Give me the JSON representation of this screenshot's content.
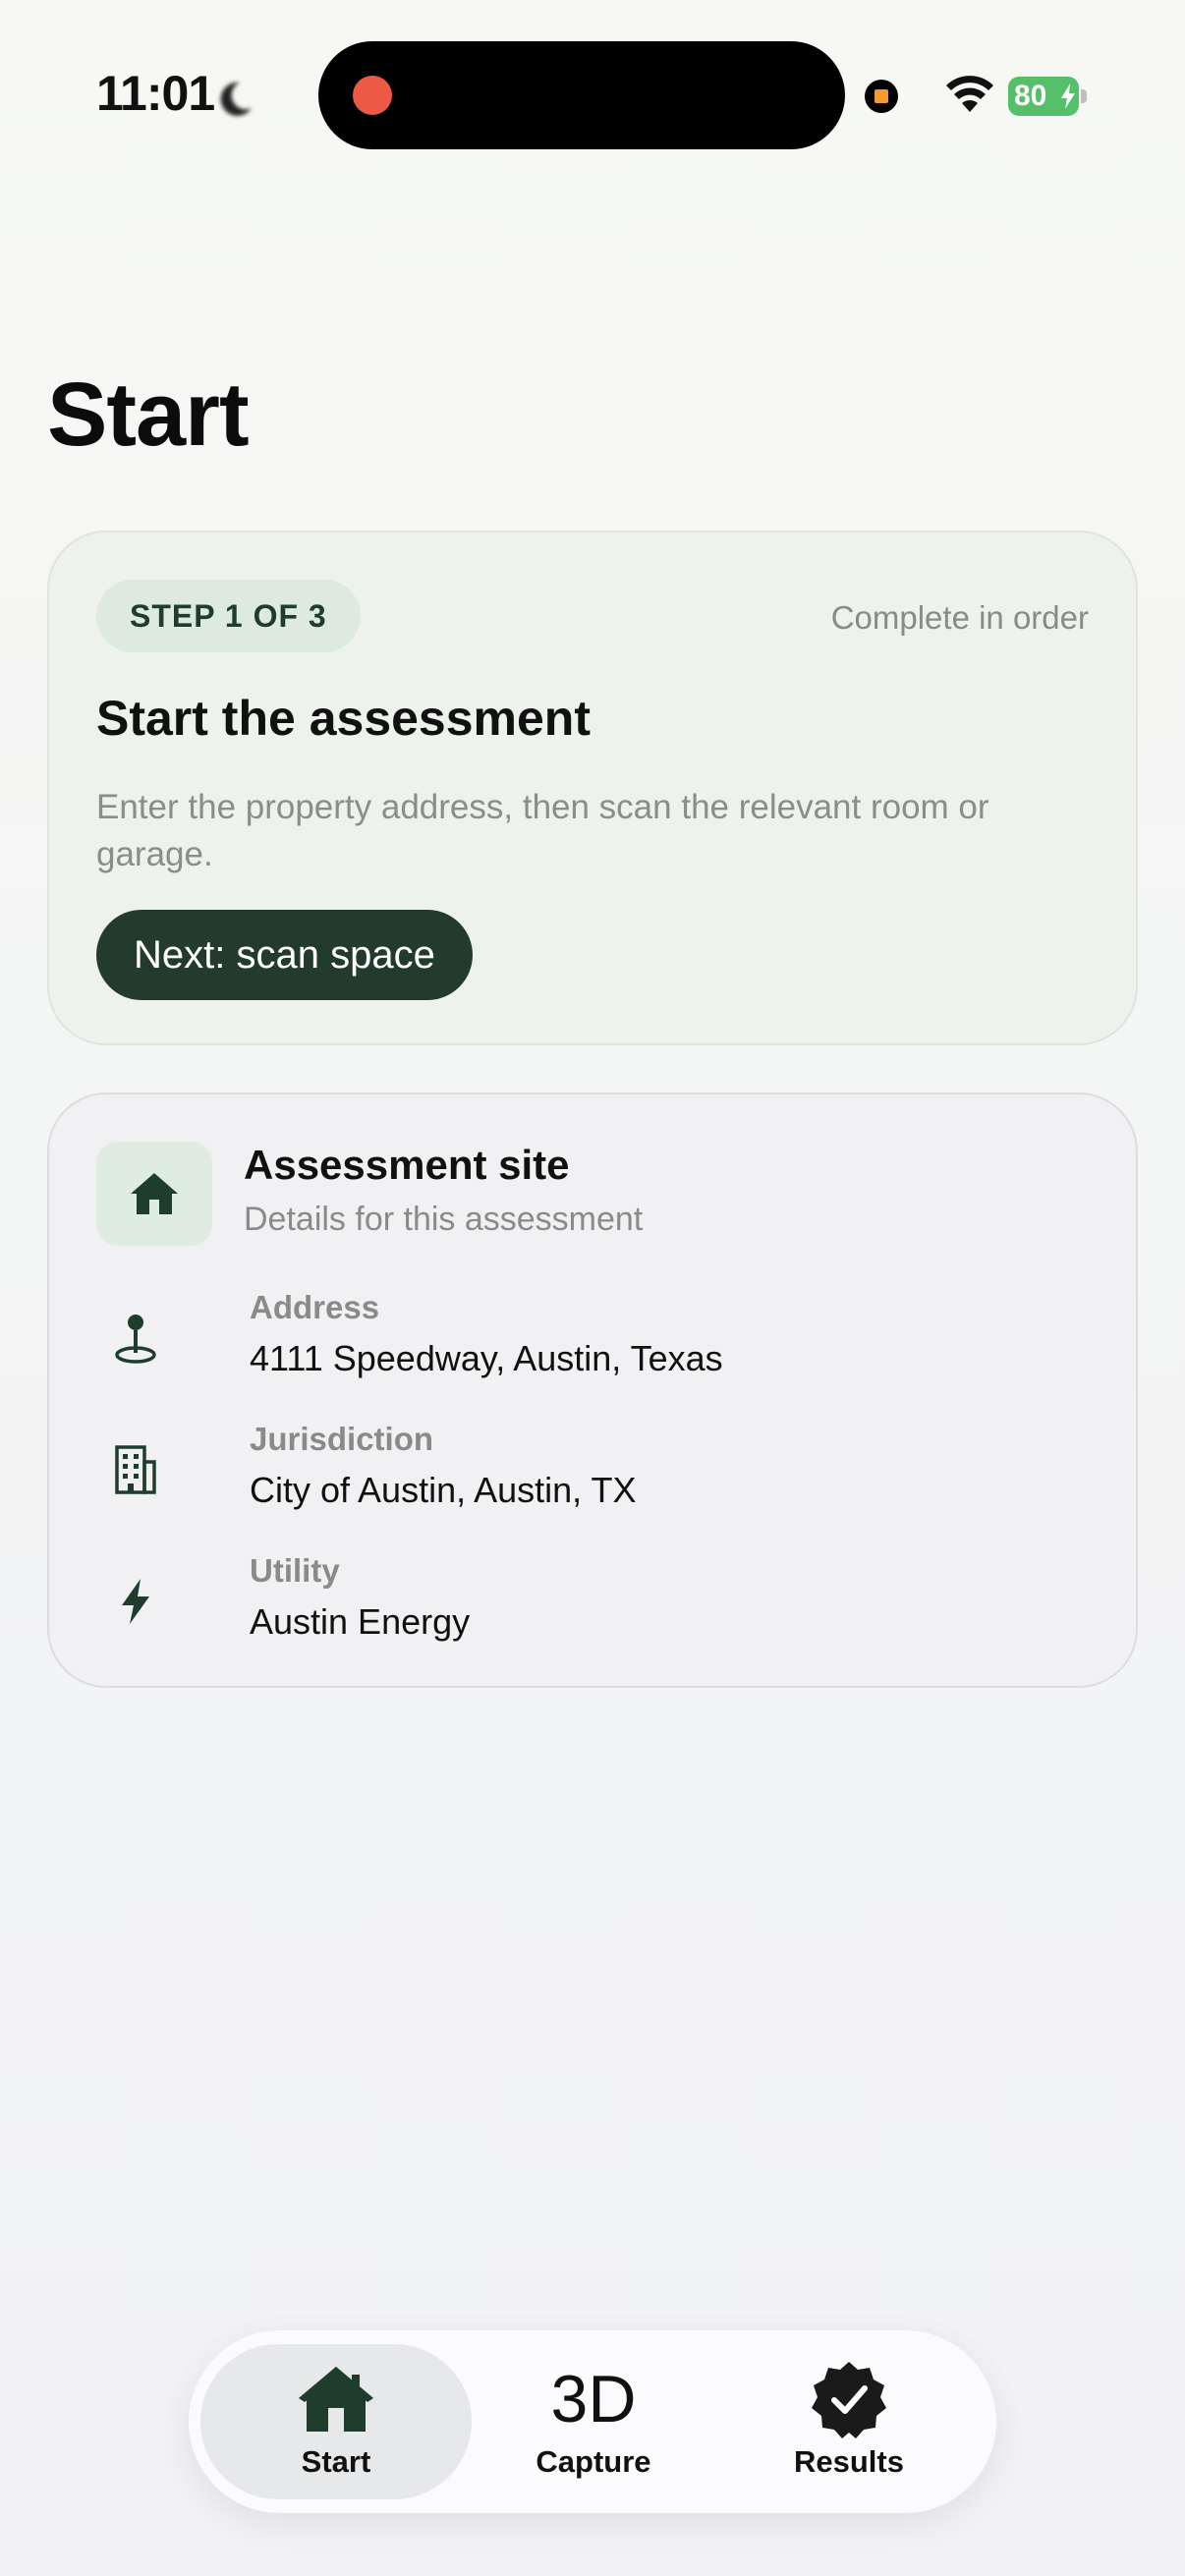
{
  "status_bar": {
    "time": "11:01",
    "battery": "80",
    "icons": [
      "moon-icon",
      "record-dot",
      "screen-recording-icon",
      "wifi-icon",
      "battery-icon"
    ]
  },
  "page": {
    "title": "Start"
  },
  "step_card": {
    "badge": "STEP 1 OF 3",
    "hint": "Complete in order",
    "title": "Start the assessment",
    "description": "Enter the property address, then scan the relevant room or garage.",
    "next_button": "Next: scan space"
  },
  "site_card": {
    "title": "Assessment site",
    "subtitle": "Details for this assessment",
    "icon": "house-icon",
    "details": [
      {
        "label": "Address",
        "value": "4111 Speedway, Austin, Texas",
        "icon": "map-pin-icon"
      },
      {
        "label": "Jurisdiction",
        "value": "City of Austin, Austin, TX",
        "icon": "building-icon"
      },
      {
        "label": "Utility",
        "value": "Austin Energy",
        "icon": "bolt-icon"
      }
    ]
  },
  "tab_bar": {
    "tabs": [
      {
        "label": "Start",
        "icon": "house-icon",
        "active": true
      },
      {
        "label": "Capture",
        "icon_text": "3D",
        "active": false
      },
      {
        "label": "Results",
        "icon": "checkmark-seal-icon",
        "active": false
      }
    ]
  },
  "colors": {
    "accent_dark_green": "#233b2c",
    "badge_green": "#dfeadf",
    "record_red": "#ec5a45",
    "battery_green": "#55c06a"
  }
}
